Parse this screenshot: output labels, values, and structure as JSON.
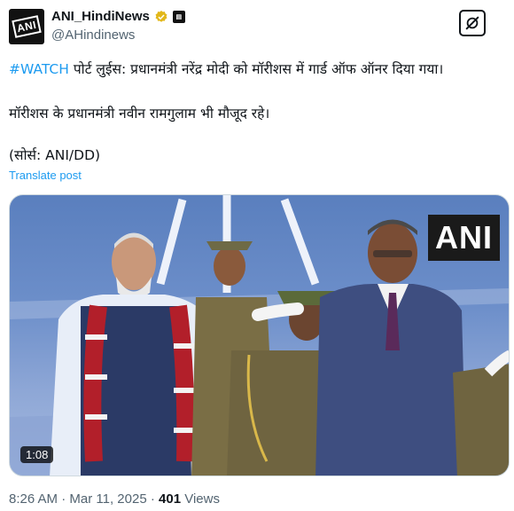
{
  "author": {
    "display_name": "ANI_HindiNews",
    "handle": "@AHindinews",
    "avatar_text": "ANI"
  },
  "tweet": {
    "hashtag": "#WATCH",
    "line1_rest": " पोर्ट लुईस: प्रधानमंत्री नरेंद्र मोदी को मॉरीशस में गार्ड ऑफ ऑनर दिया गया।",
    "line2": "मॉरीशस के प्रधानमंत्री नवीन रामगुलाम भी मौजूद रहे।",
    "line3": "(सोर्स: ANI/DD)",
    "translate_label": "Translate post"
  },
  "media": {
    "watermark": "ANI",
    "duration": "1:08"
  },
  "meta": {
    "time": "8:26 AM",
    "separator": " · ",
    "date": "Mar 11, 2025",
    "views_count": "401",
    "views_label": " Views"
  },
  "icons": {
    "verified": "verified-badge-icon",
    "grok": "grok-icon"
  },
  "colors": {
    "link": "#1d9bf0",
    "secondary_text": "#536471",
    "verified_gold": "#e2b719"
  }
}
